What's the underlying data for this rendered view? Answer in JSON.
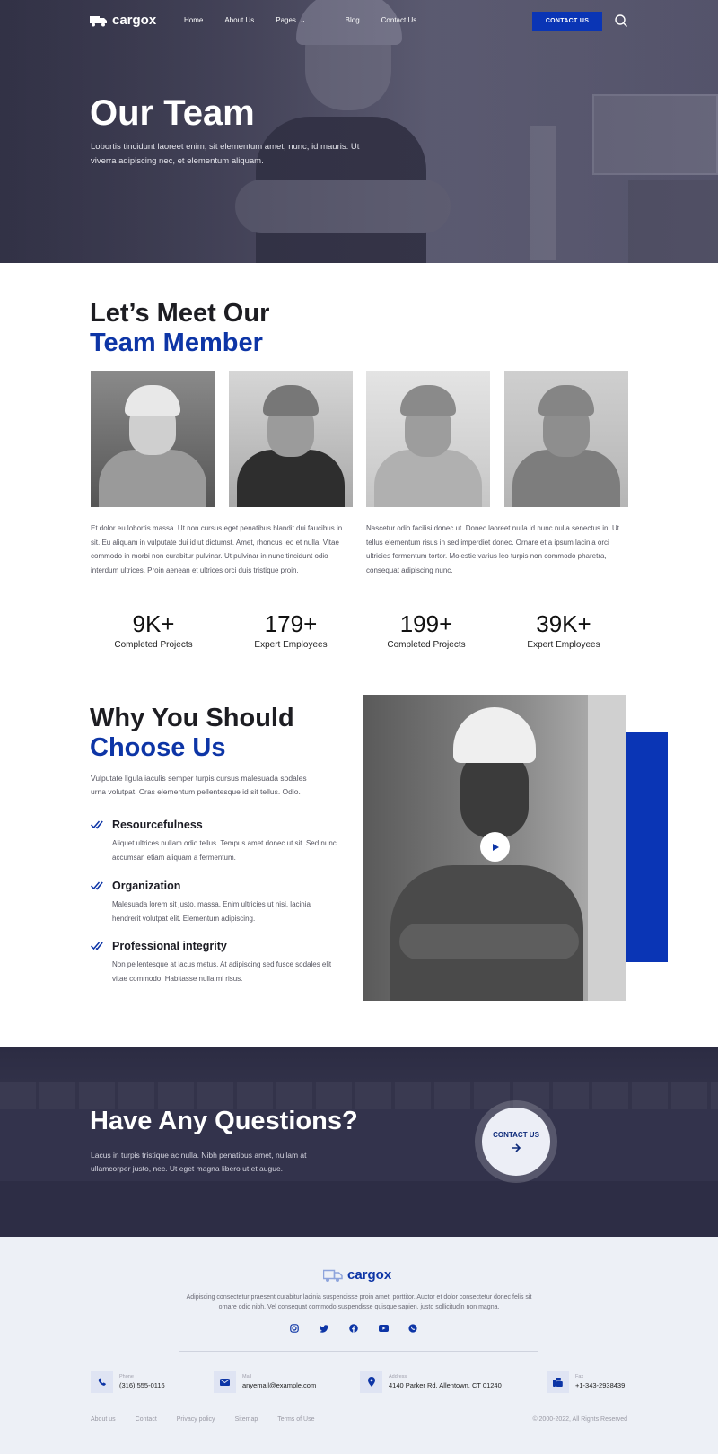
{
  "brand": {
    "name": "cargox"
  },
  "nav": {
    "items": [
      "Home",
      "About Us",
      "Pages",
      "Blog",
      "Contact Us"
    ],
    "cta": "CONTACT US"
  },
  "hero": {
    "title": "Our Team",
    "text": "Lobortis tincidunt laoreet enim, sit elementum amet, nunc, id mauris. Ut viverra adipiscing nec, et elementum aliquam."
  },
  "meet": {
    "title_line1": "Let’s Meet Our",
    "title_line2": "Team Member",
    "text_left": "Et dolor eu lobortis massa. Ut non cursus eget penatibus blandit dui faucibus in sit. Eu aliquam in vulputate dui id ut dictumst. Amet, rhoncus leo et nulla. Vitae commodo in morbi non curabitur pulvinar. Ut pulvinar in nunc tincidunt odio interdum ultrices. Proin aenean et ultrices orci duis tristique proin.",
    "text_right": "Nascetur odio facilisi donec ut. Donec laoreet nulla id nunc nulla senectus in. Ut tellus elementum risus in sed imperdiet donec. Ornare et a ipsum lacinia orci ultricies fermentum tortor. Molestie varius leo turpis non commodo pharetra, consequat adipiscing nunc."
  },
  "stats": [
    {
      "value": "9K+",
      "label": "Completed Projects"
    },
    {
      "value": "179+",
      "label": "Expert Employees"
    },
    {
      "value": "199+",
      "label": "Completed Projects"
    },
    {
      "value": "39K+",
      "label": "Expert Employees"
    }
  ],
  "why": {
    "title_line1": "Why You Should",
    "title_line2": "Choose Us",
    "intro": "Vulputate ligula iaculis semper turpis cursus malesuada sodales urna volutpat. Cras elementum pellentesque id sit tellus. Odio.",
    "features": [
      {
        "title": "Resourcefulness",
        "text": "Aliquet ultrices nullam odio tellus. Tempus amet donec ut sit. Sed nunc accumsan etiam aliquam a fermentum."
      },
      {
        "title": "Organization",
        "text": "Malesuada lorem sit justo, massa. Enim ultricies ut nisi, lacinia hendrerit volutpat elit. Elementum adipiscing."
      },
      {
        "title": "Professional integrity",
        "text": "Non pellentesque at lacus metus. At adipiscing sed fusce sodales elit vitae commodo. Habitasse nulla mi risus."
      }
    ]
  },
  "cta": {
    "title": "Have Any Questions?",
    "text": "Lacus in turpis tristique ac nulla. Nibh penatibus amet, nullam at ullamcorper justo, nec. Ut eget magna libero ut et augue.",
    "button": "CONTACT US"
  },
  "footer": {
    "description": "Adipiscing consectetur praesent curabitur lacinia suspendisse proin amet, porttitor. Auctor et dolor consectetur donec felis sit ornare odio nibh. Vel consequat commodo suspendisse quisque sapien, justo sollicitudin non magna.",
    "socials": [
      "instagram-icon",
      "twitter-icon",
      "facebook-icon",
      "youtube-icon",
      "whatsapp-icon"
    ],
    "contacts": [
      {
        "label": "Phone",
        "value": "(316) 555-0116",
        "icon": "phone-icon"
      },
      {
        "label": "Mail",
        "value": "anyemail@example.com",
        "icon": "mail-icon"
      },
      {
        "label": "Address",
        "value": "4140 Parker Rd. Allentown, CT 01240",
        "icon": "location-icon"
      },
      {
        "label": "Fax",
        "value": "+1-343-2938439",
        "icon": "fax-icon"
      }
    ],
    "links": [
      "About us",
      "Contact",
      "Privacy policy",
      "Sitemap",
      "Terms of Use"
    ],
    "copyright": "© 2000-2022, All Rights Reserved"
  },
  "colors": {
    "accent": "#0a35b5",
    "dark_overlay": "#3a3a50",
    "footer_bg": "#edf0f6"
  }
}
